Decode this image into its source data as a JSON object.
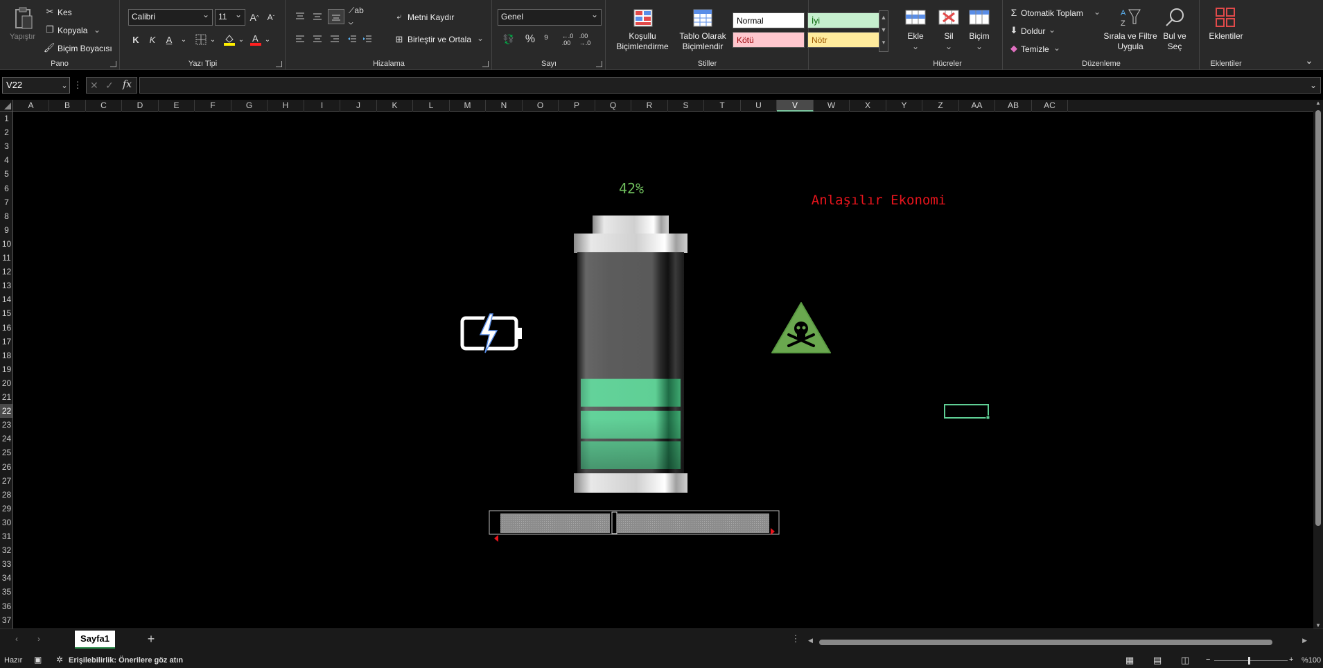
{
  "ribbon": {
    "pano": {
      "label": "Pano",
      "paste": "Yapıştır",
      "cut": "Kes",
      "copy": "Kopyala",
      "format_painter": "Biçim Boyacısı"
    },
    "font": {
      "label": "Yazı Tipi",
      "name": "Calibri",
      "size": "11",
      "bold": "K",
      "italic": "K",
      "underline": "A"
    },
    "alignment": {
      "label": "Hizalama",
      "wrap": "Metni Kaydır",
      "merge": "Birleştir ve Ortala"
    },
    "number": {
      "label": "Sayı",
      "format": "Genel",
      "percent": "%",
      "comma": "⁹"
    },
    "styles": {
      "label": "Stiller",
      "conditional": "Koşullu Biçimlendirme",
      "table": "Tablo Olarak Biçimlendir",
      "cells": [
        {
          "name": "Normal",
          "bg": "#ffffff",
          "fg": "#000000"
        },
        {
          "name": "İyi",
          "bg": "#c6efce",
          "fg": "#006100"
        },
        {
          "name": "Kötü",
          "bg": "#ffc7ce",
          "fg": "#9c0006"
        },
        {
          "name": "Nötr",
          "bg": "#ffeb9c",
          "fg": "#9c5700"
        }
      ]
    },
    "cells_group": {
      "label": "Hücreler",
      "insert": "Ekle",
      "delete": "Sil",
      "format": "Biçim"
    },
    "editing": {
      "label": "Düzenleme",
      "autosum": "Otomatik Toplam",
      "fill": "Doldur",
      "clear": "Temizle",
      "sort": "Sırala ve Filtre Uygula",
      "find": "Bul ve Seç"
    },
    "addins": {
      "label": "Eklentiler",
      "button": "Eklentiler"
    }
  },
  "formula_bar": {
    "name_box": "V22",
    "fx": "fx",
    "formula": ""
  },
  "columns": [
    "A",
    "B",
    "C",
    "D",
    "E",
    "F",
    "G",
    "H",
    "I",
    "J",
    "K",
    "L",
    "M",
    "N",
    "O",
    "P",
    "Q",
    "R",
    "S",
    "T",
    "U",
    "V",
    "W",
    "X",
    "Y",
    "Z",
    "AA",
    "AB",
    "AC"
  ],
  "selected_column": "V",
  "rows": [
    "1",
    "2",
    "3",
    "4",
    "5",
    "6",
    "7",
    "8",
    "9",
    "10",
    "11",
    "12",
    "13",
    "14",
    "15",
    "16",
    "17",
    "18",
    "19",
    "20",
    "21",
    "22",
    "23",
    "24",
    "25",
    "26",
    "27",
    "28",
    "29",
    "30",
    "31",
    "32",
    "33",
    "34",
    "35",
    "36",
    "37"
  ],
  "selected_row": "22",
  "canvas": {
    "percent_text": "42%",
    "percent_color": "#6ebd5c",
    "brand_text": "Anlaşılır Ekonomi",
    "brand_color": "#e8141c",
    "charge_fraction": 0.42,
    "battery_green": "#5fcf95",
    "charging_icon": "charging-battery-icon",
    "warning_icon": "skull-warning-icon"
  },
  "sheets": {
    "active": "Sayfa1",
    "add": "+"
  },
  "status_bar": {
    "ready": "Hazır",
    "accessibility": "Erişilebilirlik: Önerilere göz atın",
    "zoom": "%100"
  }
}
